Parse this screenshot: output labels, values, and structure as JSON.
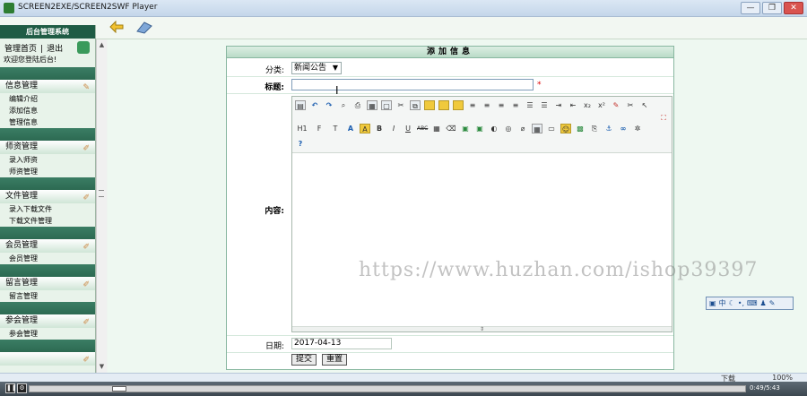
{
  "window": {
    "title": "SCREEN2EXE/SCREEN2SWF Player",
    "buttons": {
      "minimize": "—",
      "restore": "❐",
      "close": "✕"
    }
  },
  "sidebar": {
    "header": "后台管理系统",
    "links": {
      "home": "管理首页",
      "sep": "|",
      "logout": "退出"
    },
    "welcome": "欢迎您登陆后台!",
    "sections": [
      {
        "title": "信息管理",
        "items": [
          "编辑介绍",
          "添加信息",
          "管理信息"
        ]
      },
      {
        "title": "师资管理",
        "items": [
          "录入师资",
          "师资管理"
        ]
      },
      {
        "title": "文件管理",
        "items": [
          "录入下载文件",
          "下载文件管理"
        ]
      },
      {
        "title": "会员管理",
        "items": [
          "会员管理"
        ]
      },
      {
        "title": "留言管理",
        "items": [
          "留言管理"
        ]
      },
      {
        "title": "参会管理",
        "items": [
          "参会管理"
        ]
      }
    ]
  },
  "form": {
    "title": "添加信息",
    "category_label": "分类:",
    "category_value": "新闻公告",
    "title_label": "标题:",
    "title_value": "",
    "required_mark": "*",
    "content_label": "内容:",
    "date_label": "日期:",
    "date_value": "2017-04-13",
    "submit_label": "提交",
    "reset_label": "重置"
  },
  "editor": {
    "heading_btn": "H1",
    "font_btn": "F",
    "size_btn": "T",
    "bold": "B",
    "italic": "I",
    "underline": "U",
    "strike": "ABC",
    "resize_grip": "⇕"
  },
  "watermark": "https://www.huzhan.com/ishop39397",
  "ime": {
    "lang": "中"
  },
  "status": {
    "download": "下载",
    "zoom": "100%"
  },
  "player": {
    "time": "0:49/5:43"
  },
  "colors": {
    "sidebar_header": "#1f5c45",
    "section_bar": "#2d6a52",
    "required": "#d00000",
    "form_border": "#88b7a0"
  }
}
